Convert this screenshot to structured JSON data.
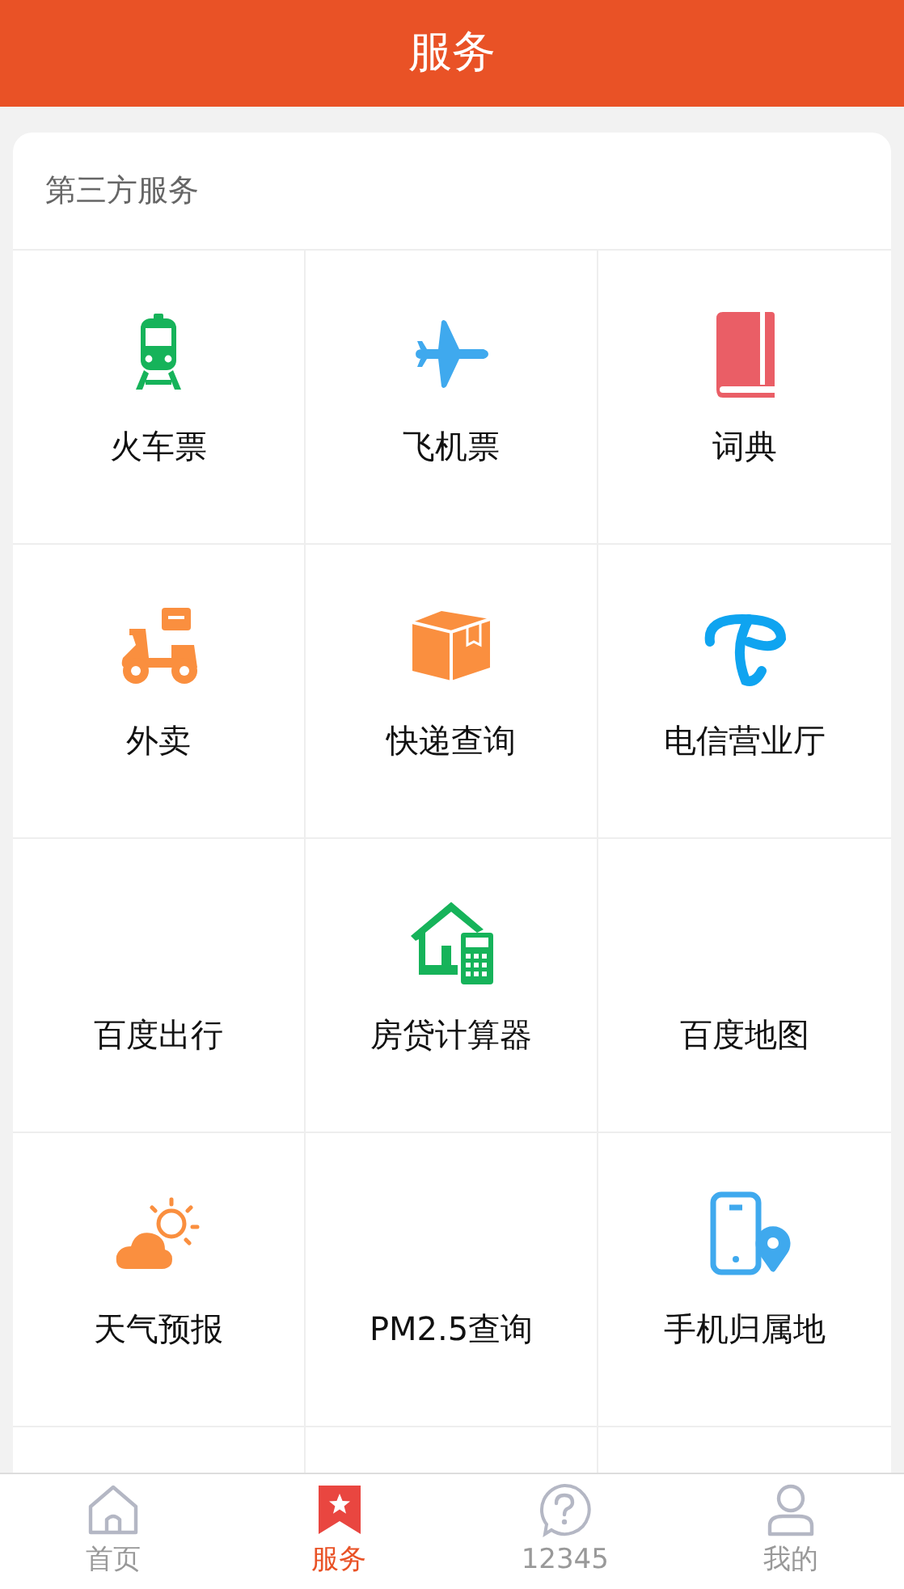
{
  "header": {
    "title": "服务"
  },
  "section": {
    "title": "第三方服务",
    "items": [
      {
        "label": "火车票",
        "kind": "train"
      },
      {
        "label": "飞机票",
        "kind": "plane"
      },
      {
        "label": "词典",
        "kind": "book"
      },
      {
        "label": "外卖",
        "kind": "scooter"
      },
      {
        "label": "快递查询",
        "kind": "box"
      },
      {
        "label": "电信营业厅",
        "kind": "telecom"
      },
      {
        "label": "百度出行",
        "kind": "none"
      },
      {
        "label": "房贷计算器",
        "kind": "house"
      },
      {
        "label": "百度地图",
        "kind": "none"
      },
      {
        "label": "天气预报",
        "kind": "weather"
      },
      {
        "label": "PM2.5查询",
        "kind": "none"
      },
      {
        "label": "手机归属地",
        "kind": "phone"
      }
    ]
  },
  "tab_bar": [
    {
      "label": "首页",
      "kind": "home",
      "selected": false
    },
    {
      "label": "服务",
      "kind": "bookmark",
      "selected": true
    },
    {
      "label": "12345",
      "kind": "help",
      "selected": false
    },
    {
      "label": "我的",
      "kind": "user",
      "selected": false
    }
  ]
}
